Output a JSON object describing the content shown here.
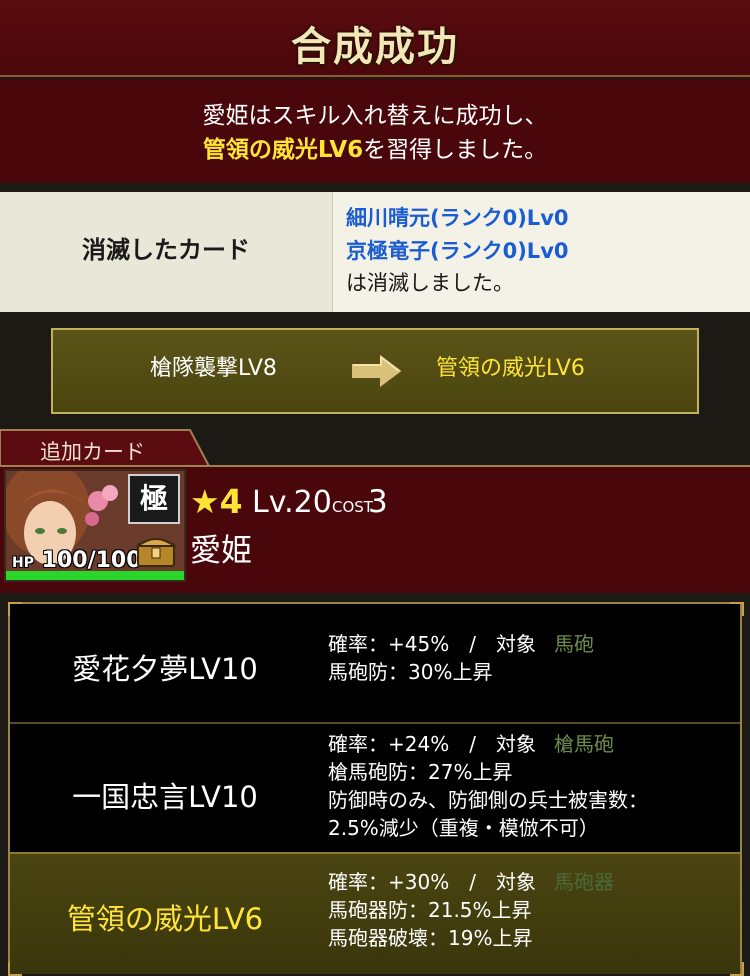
{
  "header": {
    "title": "合成成功",
    "message_line1": "愛姫はスキル入れ替えに成功し、",
    "message_skill": "管領の威光LV6",
    "message_suffix": "を習得しました。"
  },
  "consumed": {
    "label": "消滅したカード",
    "cards": [
      "細川晴元(ランク0)Lv0",
      "京極竜子(ランク0)Lv0"
    ],
    "suffix": "は消滅しました。"
  },
  "swap": {
    "old_skill": "槍隊襲撃LV8",
    "new_skill": "管領の威光LV6",
    "arrow_icon": "right-arrow-icon"
  },
  "added_card": {
    "tab_label": "追加カード",
    "hp_label": "HP",
    "hp": "100/100",
    "hp_fraction": 1.0,
    "badge": "極",
    "rarity": "★4",
    "level": "Lv.20",
    "cost_label": "COST",
    "cost": "3",
    "name": "愛姫"
  },
  "skills": [
    {
      "name": "愛花夕夢LV10",
      "rate": "確率：+45%",
      "sep": "/",
      "target_label": "対象",
      "target": "馬砲",
      "effects": [
        "馬砲防：30%上昇"
      ]
    },
    {
      "name": "一国忠言LV10",
      "rate": "確率：+24%",
      "sep": "/",
      "target_label": "対象",
      "target": "槍馬砲",
      "effects": [
        "槍馬砲防：27%上昇",
        "防御時のみ、防御側の兵士被害数：",
        "2.5%減少（重複・模倣不可）"
      ]
    },
    {
      "name": "管領の威光LV6",
      "rate": "確率：+30%",
      "sep": "/",
      "target_label": "対象",
      "target": "馬砲器",
      "effects": [
        "馬砲器防：21.5%上昇",
        "馬砲器破壊：19%上昇"
      ]
    }
  ],
  "colors": {
    "header_bg": "#4a070b",
    "highlight": "#ffe437",
    "link_blue": "#1a5cd1",
    "hp_green": "#2ad62a"
  }
}
